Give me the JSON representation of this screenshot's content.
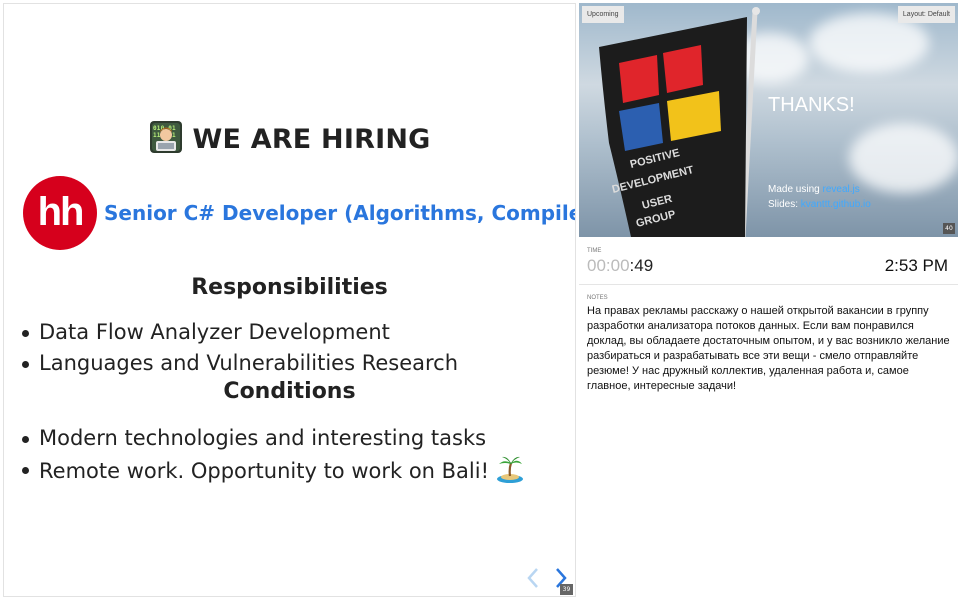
{
  "current_slide": {
    "title": "WE ARE HIRING",
    "logo_text": "hh",
    "job_title": "Senior C# Developer (Algorithms, Compilers)",
    "responsibilities_heading": "Responsibilities",
    "responsibilities": [
      "Data Flow Analyzer Development",
      "Languages and Vulnerabilities Research"
    ],
    "conditions_heading": "Conditions",
    "conditions": [
      "Modern technologies and interesting tasks",
      "Remote work. Opportunity to work on Bali!"
    ],
    "slide_number": "39",
    "nav": {
      "prev_icon": "chevron-left-icon",
      "next_icon": "chevron-right-icon"
    }
  },
  "upcoming": {
    "label": "Upcoming",
    "layout_label": "Layout: Default",
    "flag_text": [
      "POSITIVE",
      "DEVELOPMENT",
      "USER",
      "GROUP"
    ],
    "thanks": "THANKS!",
    "made_using_prefix": "Made using ",
    "made_using_link": "reveal.js",
    "slides_prefix": "Slides: ",
    "slides_link": "kvanttt.github.io",
    "slide_number": "40"
  },
  "time": {
    "label": "TIME",
    "elapsed_dim": "00:00",
    "elapsed_sec": ":49",
    "clock": "2:53 PM"
  },
  "notes": {
    "label": "NOTES",
    "text": "На правах рекламы расскажу о нашей открытой вакансии в группу разработки анализатора потоков данных. Если вам понравился доклад, вы обладаете достаточным опытом, и у вас возникло желание разбираться и разрабатывать все эти вещи - смело отправляйте резюме! У нас дружный коллектив, удаленная работа и, самое главное, интересные задачи!"
  },
  "colors": {
    "accent": "#2a76dd",
    "hh_red": "#d6001c",
    "link": "#3fa9ff"
  }
}
